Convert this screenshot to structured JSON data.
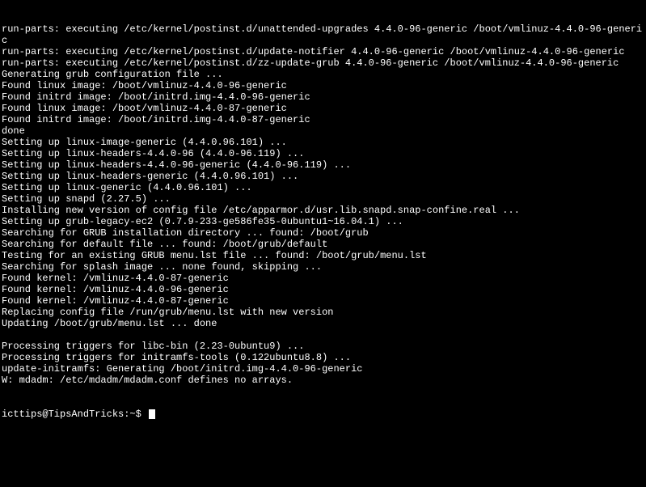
{
  "lines": [
    "run-parts: executing /etc/kernel/postinst.d/unattended-upgrades 4.4.0-96-generic /boot/vmlinuz-4.4.0-96-generic",
    "run-parts: executing /etc/kernel/postinst.d/update-notifier 4.4.0-96-generic /boot/vmlinuz-4.4.0-96-generic",
    "run-parts: executing /etc/kernel/postinst.d/zz-update-grub 4.4.0-96-generic /boot/vmlinuz-4.4.0-96-generic",
    "Generating grub configuration file ...",
    "Found linux image: /boot/vmlinuz-4.4.0-96-generic",
    "Found initrd image: /boot/initrd.img-4.4.0-96-generic",
    "Found linux image: /boot/vmlinuz-4.4.0-87-generic",
    "Found initrd image: /boot/initrd.img-4.4.0-87-generic",
    "done",
    "Setting up linux-image-generic (4.4.0.96.101) ...",
    "Setting up linux-headers-4.4.0-96 (4.4.0-96.119) ...",
    "Setting up linux-headers-4.4.0-96-generic (4.4.0-96.119) ...",
    "Setting up linux-headers-generic (4.4.0.96.101) ...",
    "Setting up linux-generic (4.4.0.96.101) ...",
    "Setting up snapd (2.27.5) ...",
    "Installing new version of config file /etc/apparmor.d/usr.lib.snapd.snap-confine.real ...",
    "Setting up grub-legacy-ec2 (0.7.9-233-ge586fe35-0ubuntu1~16.04.1) ...",
    "Searching for GRUB installation directory ... found: /boot/grub",
    "Searching for default file ... found: /boot/grub/default",
    "Testing for an existing GRUB menu.lst file ... found: /boot/grub/menu.lst",
    "Searching for splash image ... none found, skipping ...",
    "Found kernel: /vmlinuz-4.4.0-87-generic",
    "Found kernel: /vmlinuz-4.4.0-96-generic",
    "Found kernel: /vmlinuz-4.4.0-87-generic",
    "Replacing config file /run/grub/menu.lst with new version",
    "Updating /boot/grub/menu.lst ... done",
    "",
    "Processing triggers for libc-bin (2.23-0ubuntu9) ...",
    "Processing triggers for initramfs-tools (0.122ubuntu8.8) ...",
    "update-initramfs: Generating /boot/initrd.img-4.4.0-96-generic",
    "W: mdadm: /etc/mdadm/mdadm.conf defines no arrays."
  ],
  "prompt": "icttips@TipsAndTricks:~$ "
}
